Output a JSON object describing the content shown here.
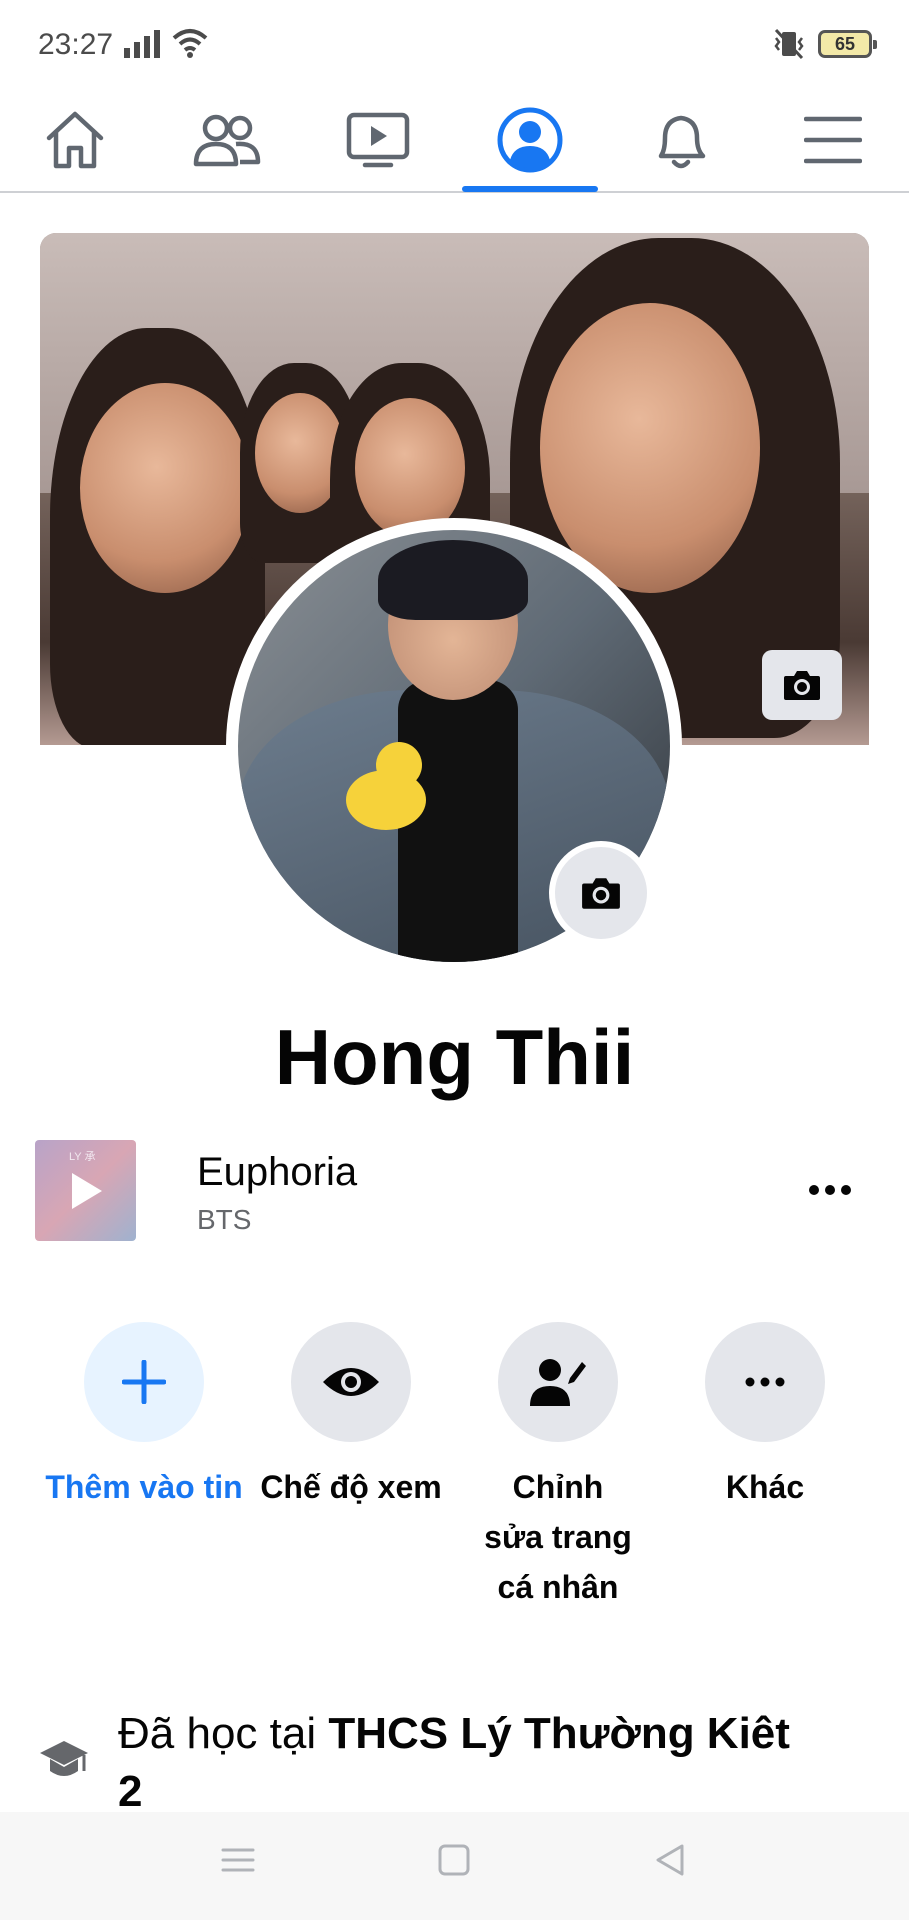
{
  "status_bar": {
    "time": "23:27",
    "battery": "65",
    "icons": [
      "signal-icon",
      "wifi-icon",
      "vibrate-icon",
      "battery-icon"
    ]
  },
  "nav": {
    "tabs": [
      {
        "name": "home-icon"
      },
      {
        "name": "friends-icon"
      },
      {
        "name": "watch-icon"
      },
      {
        "name": "profile-icon",
        "active": true
      },
      {
        "name": "notifications-icon"
      },
      {
        "name": "menu-icon"
      }
    ],
    "accent": "#1877f2"
  },
  "profile": {
    "name": "Hong Thii"
  },
  "music": {
    "title": "Euphoria",
    "artist": "BTS",
    "art_text": "LY 承"
  },
  "actions": {
    "add_story": "Thêm vào tin",
    "view_as": "Chế độ xem",
    "edit_profile": "Chỉnh sửa trang cá nhân",
    "more": "Khác"
  },
  "education": {
    "prefix": "Đã học tại ",
    "school": "THCS Lý Thường Kiêt 2"
  }
}
